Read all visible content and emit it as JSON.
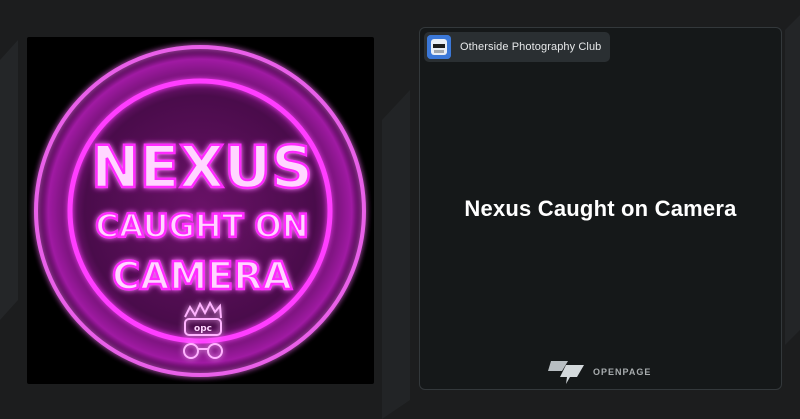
{
  "card": {
    "club_name": "Otherside Photography Club",
    "title": "Nexus Caught on Camera",
    "brand_name": "OPENPAGE"
  },
  "artwork": {
    "line1": "NEXUS",
    "line2": "CAUGHT ON",
    "line3": "CAMERA",
    "badge": "opc",
    "neon_color": "#ff29ff"
  },
  "icons": {
    "club_avatar": "club-avatar-icon",
    "brand_logo": "openpage-logo-icon"
  }
}
